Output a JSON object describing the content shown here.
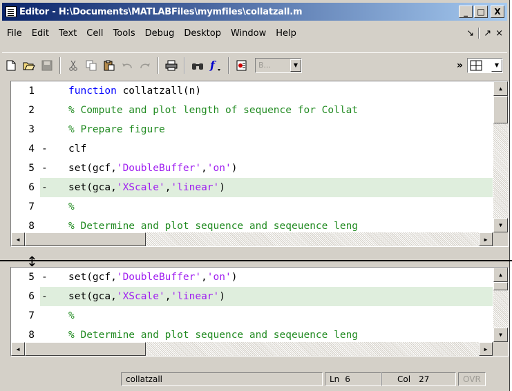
{
  "window": {
    "title": "Editor - H:\\Documents\\MATLABFiles\\mymfiles\\collatzall.m",
    "controls": [
      "_",
      "□",
      "X"
    ]
  },
  "menu": {
    "items": [
      "File",
      "Edit",
      "Text",
      "Cell",
      "Tools",
      "Debug",
      "Desktop",
      "Window",
      "Help"
    ],
    "right_icons": [
      "↘",
      "↗",
      "×"
    ]
  },
  "toolbar": {
    "icons": [
      "new-file-icon",
      "open-icon",
      "save-icon",
      "cut-icon",
      "copy-icon",
      "paste-icon",
      "undo-icon",
      "redo-icon",
      "print-icon",
      "find-icon",
      "function-icon",
      "breakpoint-icon"
    ],
    "stack_combo": "B...",
    "overflow": "»"
  },
  "editor_top": {
    "lines": [
      {
        "num": "1",
        "mark": "",
        "parts": [
          {
            "t": "function",
            "c": "kw"
          },
          {
            "t": " collatzall(n)",
            "c": ""
          }
        ]
      },
      {
        "num": "2",
        "mark": "",
        "parts": [
          {
            "t": "% Compute and plot length of sequence for Collat",
            "c": "cm"
          }
        ]
      },
      {
        "num": "3",
        "mark": "",
        "parts": [
          {
            "t": "% Prepare figure",
            "c": "cm"
          }
        ]
      },
      {
        "num": "4",
        "mark": "-",
        "parts": [
          {
            "t": "clf",
            "c": ""
          }
        ]
      },
      {
        "num": "5",
        "mark": "-",
        "parts": [
          {
            "t": "set(gcf,",
            "c": ""
          },
          {
            "t": "'DoubleBuffer'",
            "c": "str"
          },
          {
            "t": ",",
            "c": ""
          },
          {
            "t": "'on'",
            "c": "str"
          },
          {
            "t": ")",
            "c": ""
          }
        ]
      },
      {
        "num": "6",
        "mark": "-",
        "hl": true,
        "parts": [
          {
            "t": "set(gca,",
            "c": ""
          },
          {
            "t": "'XScale'",
            "c": "str"
          },
          {
            "t": ",",
            "c": ""
          },
          {
            "t": "'linear'",
            "c": "str"
          },
          {
            "t": ")",
            "c": ""
          }
        ]
      },
      {
        "num": "7",
        "mark": "",
        "parts": [
          {
            "t": "%",
            "c": "cm"
          }
        ]
      },
      {
        "num": "8",
        "mark": "",
        "parts": [
          {
            "t": "% Determine and plot sequence and seqeuence leng",
            "c": "cm"
          }
        ]
      }
    ]
  },
  "editor_bottom": {
    "lines": [
      {
        "num": "5",
        "mark": "-",
        "parts": [
          {
            "t": "set(gcf,",
            "c": ""
          },
          {
            "t": "'DoubleBuffer'",
            "c": "str"
          },
          {
            "t": ",",
            "c": ""
          },
          {
            "t": "'on'",
            "c": "str"
          },
          {
            "t": ")",
            "c": ""
          }
        ]
      },
      {
        "num": "6",
        "mark": "-",
        "hl": true,
        "parts": [
          {
            "t": "set(gca,",
            "c": ""
          },
          {
            "t": "'XScale'",
            "c": "str"
          },
          {
            "t": ",",
            "c": ""
          },
          {
            "t": "'linear'",
            "c": "str"
          },
          {
            "t": ")",
            "c": ""
          }
        ]
      },
      {
        "num": "7",
        "mark": "",
        "parts": [
          {
            "t": "%",
            "c": "cm"
          }
        ]
      },
      {
        "num": "8",
        "mark": "",
        "parts": [
          {
            "t": "% Determine and plot sequence and seqeuence leng",
            "c": "cm"
          }
        ]
      }
    ]
  },
  "status": {
    "function_name": "collatzall",
    "ln_label": "Ln",
    "ln_value": "6",
    "col_label": "Col",
    "col_value": "27",
    "ovr": "OVR"
  },
  "colors": {
    "keyword": "#0000ff",
    "comment": "#228b22",
    "string": "#a020f0",
    "highlight_line": "#dfeedd",
    "title_bar": "#0a246a"
  }
}
